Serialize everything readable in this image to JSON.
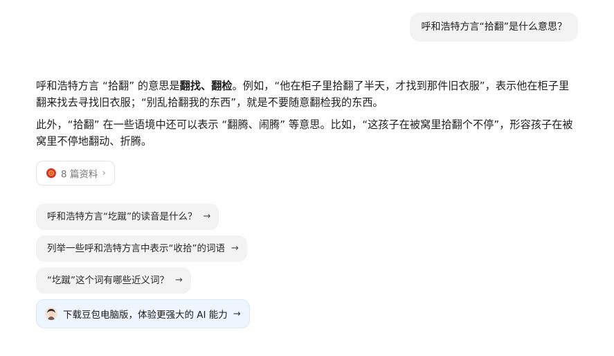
{
  "user_message": "呼和浩特方言“拾翻”是什么意思？",
  "answer": {
    "p1": {
      "t1": "呼和浩特方言 “拾翻” 的意思是",
      "bold": "翻找、翻检",
      "t2": "。例如，“他在柜子里拾翻了半天，才找到那件旧衣服”，表示他在柜子里翻来找去寻找旧衣服；“别乱拾翻我的东西”，就是不要随意翻检我的东西。"
    },
    "p2": "此外，“拾翻” 在一些语境中还可以表示 “翻腾、闹腾” 等意思。比如，“这孩子在被窝里拾翻个不停”，形容孩子在被窝里不停地翻动、折腾。"
  },
  "references": {
    "label": "8 篇资料",
    "icon": "emblem-icon",
    "accent": "#d8362a"
  },
  "suggestions": [
    "呼和浩特方言“圪蹴”的读音是什么？",
    "列举一些呼和浩特方言中表示“收拾”的词语",
    "“圪蹴”这个词有哪些近义词？"
  ],
  "download_banner": {
    "label": "下载豆包电脑版，体验更强大的 AI 能力",
    "background": "#eef5ff"
  }
}
